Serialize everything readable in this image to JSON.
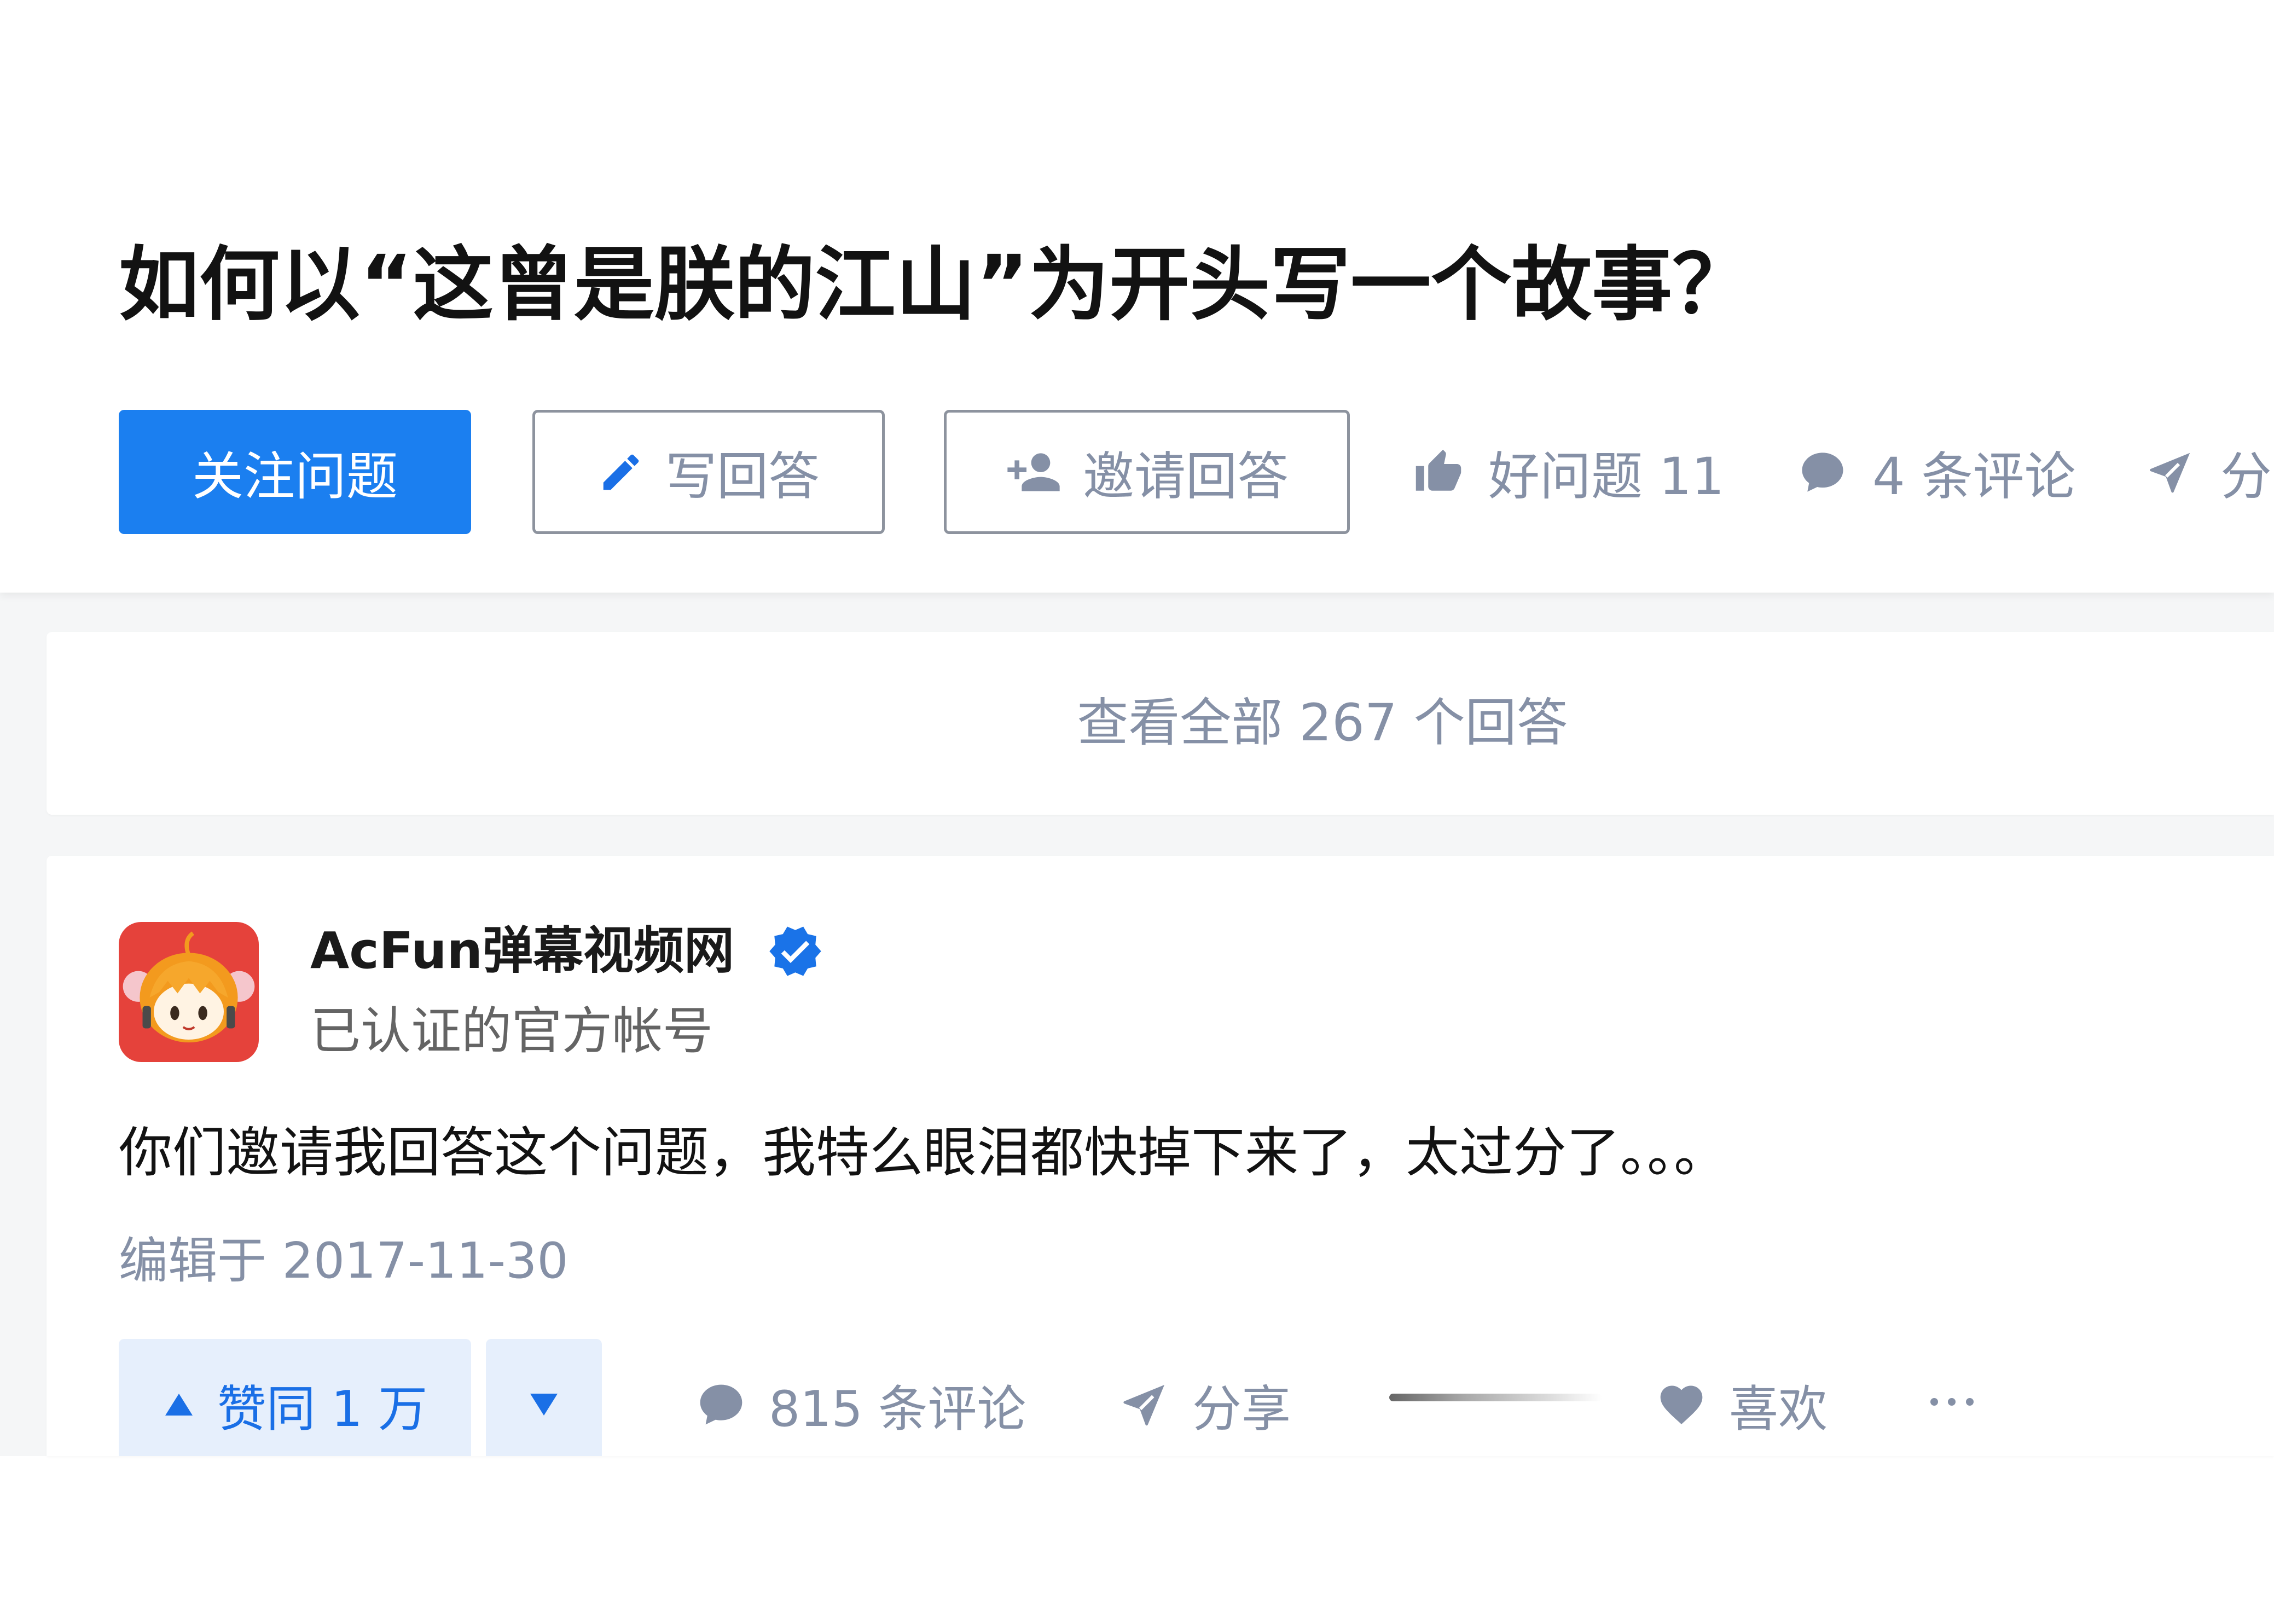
{
  "question": {
    "title": "如何以“这曾是朕的江山”为开头写一个故事？",
    "actions": {
      "follow": "关注问题",
      "write_answer": "写回答",
      "invite": "邀请回答",
      "good_question": "好问题 11",
      "comments": "4 条评论",
      "share": "分"
    }
  },
  "view_all": {
    "label": "查看全部 267 个回答"
  },
  "answer": {
    "author": {
      "name": "AcFun弹幕视频网",
      "headline": "已认证的官方帐号",
      "verified": true
    },
    "content": "你们邀请我回答这个问题，我特么眼泪都快掉下来了，太过分了。。。",
    "edited": "编辑于 2017-11-30",
    "actions": {
      "upvote": "赞同 1 万",
      "comments": "815 条评论",
      "share": "分享",
      "like": "喜欢"
    }
  },
  "icons": {
    "write_answer": "pencil-icon",
    "invite": "person-add-icon",
    "good_question": "thumbs-up-icon",
    "comments": "comment-icon",
    "share": "paper-plane-icon",
    "verified": "verified-badge-icon",
    "upvote": "triangle-up-icon",
    "downvote": "triangle-down-icon",
    "like": "heart-icon",
    "more": "more-dots-icon"
  },
  "colors": {
    "brand_blue": "#1b7ff0",
    "vote_blue": "#1a6fe6",
    "vote_background": "#e6effc",
    "muted_text": "#8590a6",
    "page_background": "#f5f6f7",
    "verified_blue": "#1a73e8"
  }
}
